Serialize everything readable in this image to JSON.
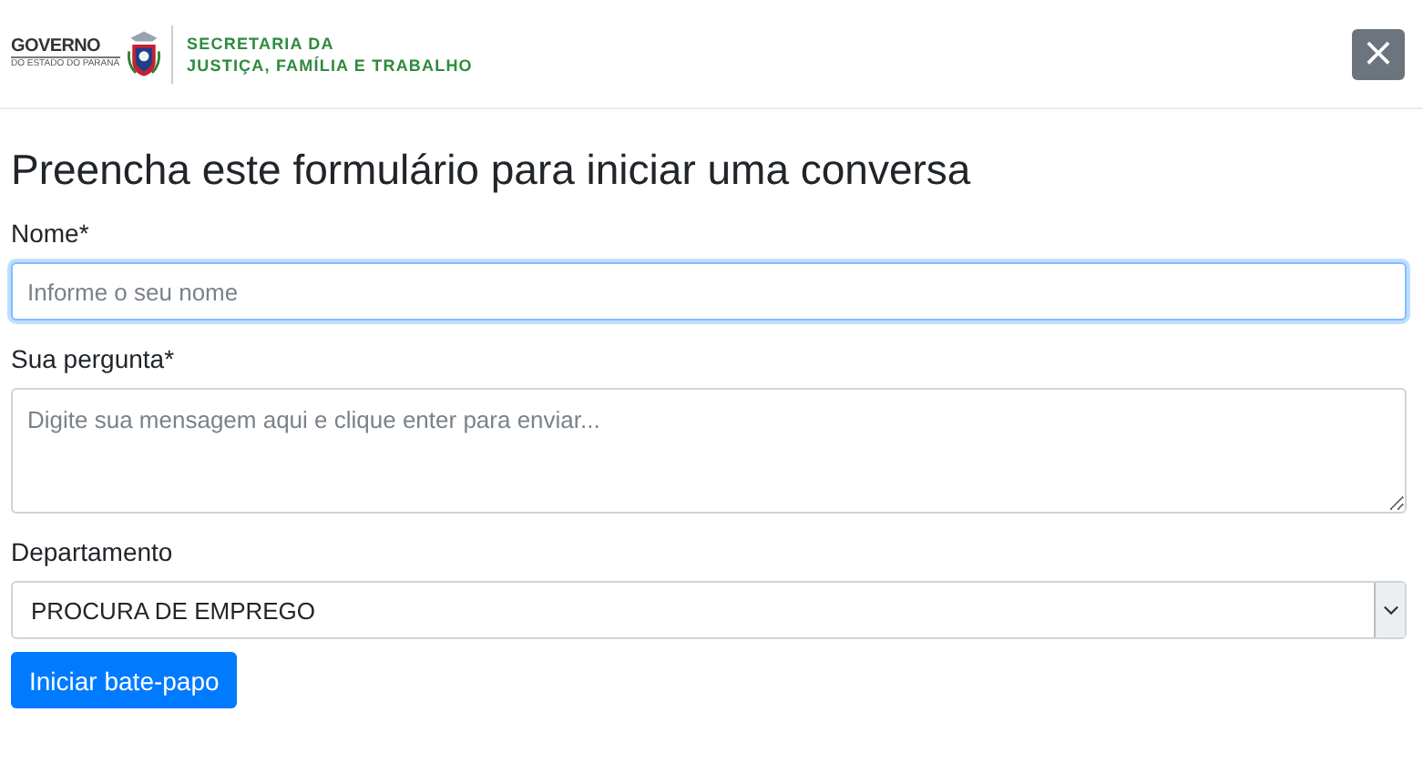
{
  "header": {
    "logo_title": "GOVERNO",
    "logo_subtitle": "DO ESTADO DO PARANÁ",
    "department_lines": [
      "SECRETARIA DA",
      "JUSTIÇA, FAMÍLIA E TRABALHO"
    ],
    "close_label": "×"
  },
  "form": {
    "title": "Preencha este formulário para iniciar uma conversa",
    "fields": [
      {
        "kind": "input",
        "label": "Nome*",
        "placeholder": "Informe o seu nome",
        "focused": true
      },
      {
        "kind": "textarea",
        "label": "Sua pergunta*",
        "placeholder": "Digite sua mensagem aqui e clique enter para enviar...",
        "focused": false
      },
      {
        "kind": "select",
        "label": "Departamento",
        "value": "PROCURA DE EMPREGO",
        "focused": false
      }
    ],
    "submit": "Iniciar bate-papo"
  }
}
